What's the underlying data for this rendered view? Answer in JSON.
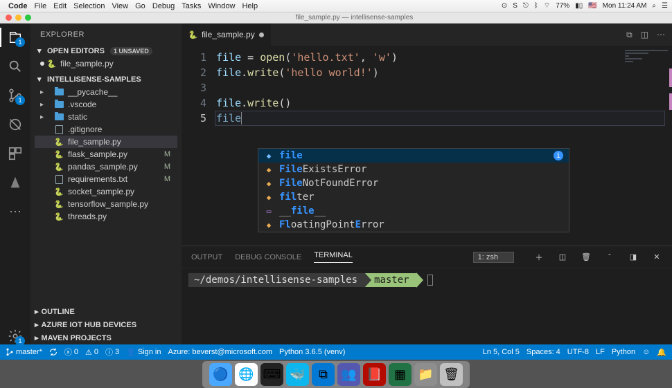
{
  "mac_menu": {
    "app": "Code",
    "items": [
      "File",
      "Edit",
      "Selection",
      "View",
      "Go",
      "Debug",
      "Tasks",
      "Window",
      "Help"
    ],
    "battery": "77%",
    "clock": "Mon 11:24 AM"
  },
  "window_title": "file_sample.py — intellisense-samples",
  "sidebar": {
    "header": "EXPLORER",
    "open_editors": {
      "title": "OPEN EDITORS",
      "badge": "1 UNSAVED",
      "items": [
        {
          "label": "file_sample.py",
          "modified": true
        }
      ]
    },
    "workspace": {
      "title": "INTELLISENSE-SAMPLES",
      "items": [
        {
          "type": "folder",
          "label": "__pycache__",
          "chev": true
        },
        {
          "type": "folder",
          "label": ".vscode",
          "chev": true
        },
        {
          "type": "folder",
          "label": "static",
          "chev": true
        },
        {
          "type": "file",
          "label": ".gitignore",
          "icon": "git"
        },
        {
          "type": "py",
          "label": "file_sample.py",
          "selected": true
        },
        {
          "type": "py",
          "label": "flask_sample.py",
          "git": "M"
        },
        {
          "type": "py",
          "label": "pandas_sample.py",
          "git": "M"
        },
        {
          "type": "file",
          "label": "requirements.txt",
          "icon": "txt",
          "git": "M"
        },
        {
          "type": "py",
          "label": "socket_sample.py"
        },
        {
          "type": "py",
          "label": "tensorflow_sample.py"
        },
        {
          "type": "py",
          "label": "threads.py"
        }
      ]
    },
    "collapsed": [
      "OUTLINE",
      "AZURE IOT HUB DEVICES",
      "MAVEN PROJECTS"
    ]
  },
  "activity_badges": {
    "explorer": "1",
    "scm": "1",
    "settings": "1"
  },
  "editor": {
    "tab_label": "file_sample.py",
    "lines": [
      [
        {
          "t": "file",
          "c": "v"
        },
        {
          "t": " = ",
          "c": "p"
        },
        {
          "t": "open",
          "c": "f"
        },
        {
          "t": "(",
          "c": "p"
        },
        {
          "t": "'hello.txt'",
          "c": "s"
        },
        {
          "t": ", ",
          "c": "p"
        },
        {
          "t": "'w'",
          "c": "s"
        },
        {
          "t": ")",
          "c": "p"
        }
      ],
      [
        {
          "t": "file",
          "c": "v"
        },
        {
          "t": ".",
          "c": "p"
        },
        {
          "t": "write",
          "c": "f"
        },
        {
          "t": "(",
          "c": "p"
        },
        {
          "t": "'hello world!'",
          "c": "s"
        },
        {
          "t": ")",
          "c": "p"
        }
      ],
      [],
      [
        {
          "t": "file",
          "c": "v"
        },
        {
          "t": ".",
          "c": "p"
        },
        {
          "t": "write",
          "c": "f"
        },
        {
          "t": "()",
          "c": "p"
        }
      ],
      [
        {
          "t": "file",
          "c": "v"
        }
      ]
    ],
    "cursor_line": 5
  },
  "suggest": [
    {
      "icon": "var",
      "match": "file",
      "rest": "",
      "sel": true,
      "info": true
    },
    {
      "icon": "class",
      "match": "File",
      "rest": "ExistsError"
    },
    {
      "icon": "class",
      "match": "File",
      "rest": "NotFoundError"
    },
    {
      "icon": "class",
      "match": "fil",
      "rest": "ter"
    },
    {
      "icon": "const",
      "match": "file",
      "rest": "",
      "pre": "__",
      "post": "__"
    },
    {
      "icon": "class",
      "match": "Fl",
      "rest": "oatingPoint",
      "match2": "E",
      "rest2": "rror"
    }
  ],
  "panel": {
    "tabs": [
      "OUTPUT",
      "DEBUG CONSOLE",
      "TERMINAL"
    ],
    "active_tab": "TERMINAL",
    "term_select": "1: zsh",
    "prompt_path": "~/demos/intellisense-samples",
    "prompt_branch": "master"
  },
  "status": {
    "branch": "master*",
    "sync": "",
    "errors": "0",
    "warnings": "0",
    "info": "3",
    "signin": "Sign in",
    "azure": "Azure: beverst@microsoft.com",
    "python": "Python 3.6.5 (venv)",
    "cursor": "Ln 5, Col 5",
    "spaces": "Spaces: 4",
    "encoding": "UTF-8",
    "eol": "LF",
    "lang": "Python"
  },
  "dock_apps": [
    "finder",
    "chrome",
    "terminal",
    "docker",
    "vscode",
    "teams",
    "acrobat",
    "excel",
    "folder",
    "trash"
  ]
}
